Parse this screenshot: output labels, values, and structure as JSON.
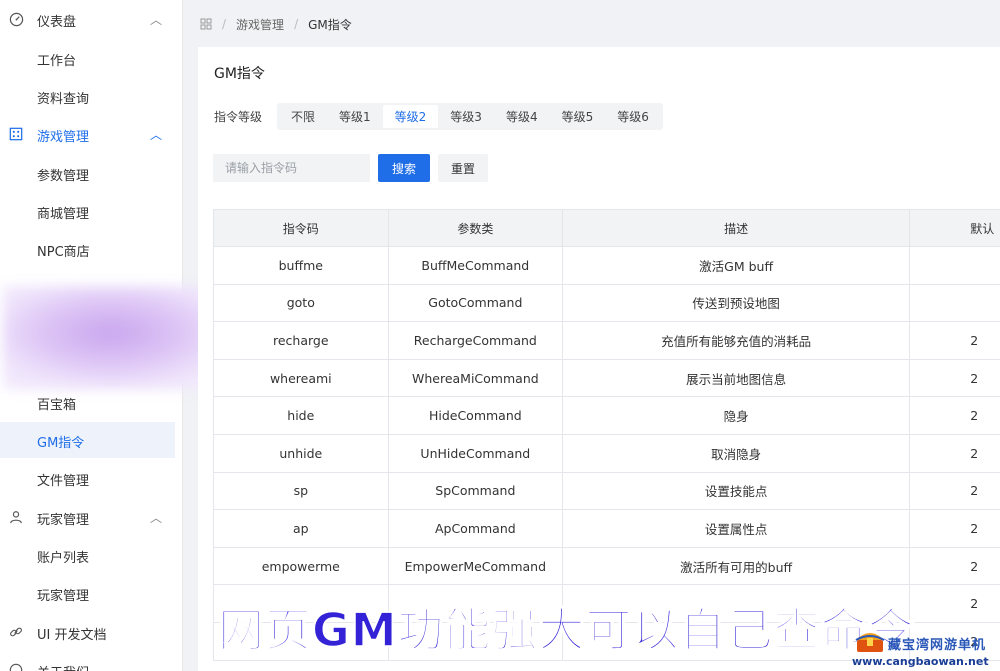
{
  "sidebar": {
    "groups": [
      {
        "label": "仪表盘",
        "icon": "dashboard-icon"
      },
      {
        "label": "游戏管理",
        "icon": "game-icon"
      },
      {
        "label": "玩家管理",
        "icon": "user-icon"
      },
      {
        "label": "UI 开发文档",
        "icon": "link-icon"
      },
      {
        "label": "关于我们",
        "icon": "info-icon"
      }
    ],
    "items": [
      {
        "label": "工作台"
      },
      {
        "label": "资料查询"
      },
      {
        "label": "参数管理"
      },
      {
        "label": "商城管理"
      },
      {
        "label": "NPC商店"
      },
      {
        "label": "百宝箱"
      },
      {
        "label": "GM指令"
      },
      {
        "label": "文件管理"
      },
      {
        "label": "账户列表"
      },
      {
        "label": "玩家管理"
      }
    ]
  },
  "breadcrumb": {
    "items": [
      "游戏管理",
      "GM指令"
    ],
    "home_icon": "home-icon"
  },
  "page": {
    "title": "GM指令"
  },
  "filter": {
    "label": "指令等级",
    "tabs": [
      "不限",
      "等级1",
      "等级2",
      "等级3",
      "等级4",
      "等级5",
      "等级6"
    ],
    "active_tab": "等级2"
  },
  "search": {
    "placeholder": "请输入指令码",
    "value": "",
    "search_label": "搜索",
    "reset_label": "重置"
  },
  "table": {
    "columns": [
      "指令码",
      "参数类",
      "描述",
      "默认"
    ],
    "rows": [
      [
        "buffme",
        "BuffMeCommand",
        "激活GM buff",
        ""
      ],
      [
        "goto",
        "GotoCommand",
        "传送到预设地图",
        ""
      ],
      [
        "recharge",
        "RechargeCommand",
        "充值所有能够充值的消耗品",
        "2"
      ],
      [
        "whereami",
        "WhereaMiCommand",
        "展示当前地图信息",
        "2"
      ],
      [
        "hide",
        "HideCommand",
        "隐身",
        "2"
      ],
      [
        "unhide",
        "UnHideCommand",
        "取消隐身",
        "2"
      ],
      [
        "sp",
        "SpCommand",
        "设置技能点",
        "2"
      ],
      [
        "ap",
        "ApCommand",
        "设置属性点",
        "2"
      ],
      [
        "empowerme",
        "EmpowerMeCommand",
        "激活所有可用的buff",
        "2"
      ],
      [
        "",
        "",
        "",
        "2"
      ],
      [
        "",
        "",
        "",
        "2"
      ]
    ]
  },
  "overlay": {
    "caption": "网页GM功能强大可以自己查命令",
    "watermark_name": "藏宝湾网游单机",
    "watermark_url": "www.cangbaowan.net"
  },
  "colors": {
    "accent": "#1f6ee8",
    "caption": "#3322d6"
  }
}
